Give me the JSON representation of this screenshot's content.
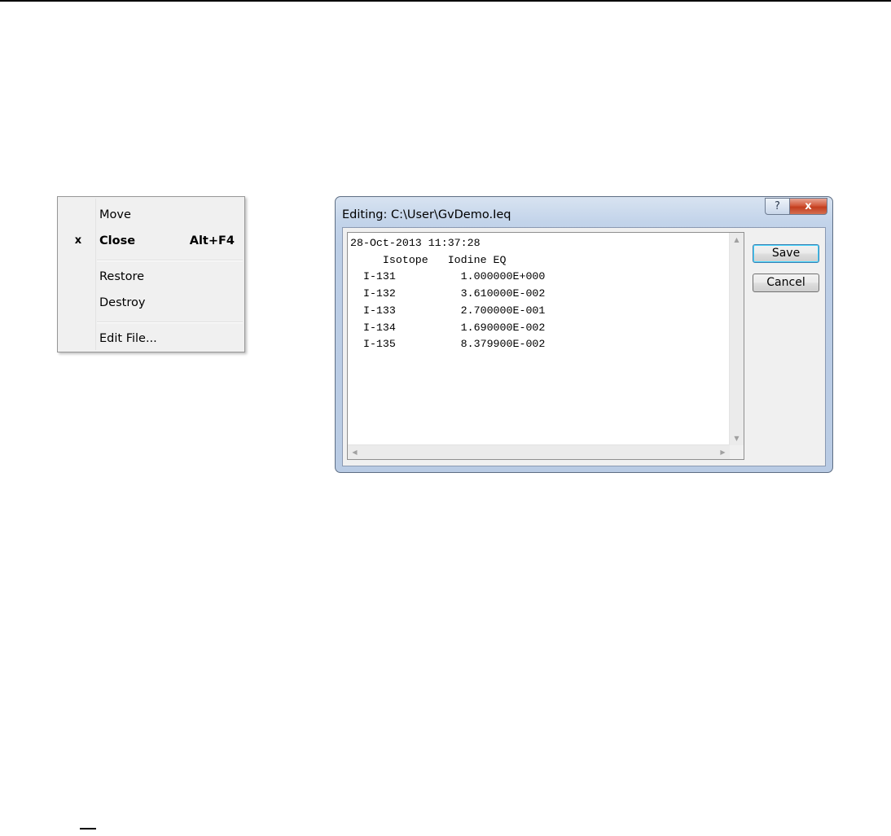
{
  "context_menu": {
    "items": [
      {
        "mark": "",
        "label": "Move",
        "shortcut": ""
      },
      {
        "mark": "x",
        "label": "Close",
        "shortcut": "Alt+F4"
      },
      {
        "mark": "",
        "label": "Restore",
        "shortcut": ""
      },
      {
        "mark": "",
        "label": "Destroy",
        "shortcut": ""
      },
      {
        "mark": "",
        "label": "Edit File...",
        "shortcut": ""
      }
    ]
  },
  "dialog": {
    "title": "Editing: C:\\User\\GvDemo.Ieq",
    "help_glyph": "?",
    "close_glyph": "x",
    "editor_lines": [
      "28-Oct-2013 11:37:28",
      "     Isotope   Iodine EQ",
      "  I-131          1.000000E+000",
      "  I-132          3.610000E-002",
      "  I-133          2.700000E-001",
      "  I-134          1.690000E-002",
      "  I-135          8.379900E-002"
    ],
    "save_label": "Save",
    "cancel_label": "Cancel",
    "scroll_up_glyph": "▲",
    "scroll_down_glyph": "▼",
    "scroll_left_glyph": "◀",
    "scroll_right_glyph": "▶"
  }
}
